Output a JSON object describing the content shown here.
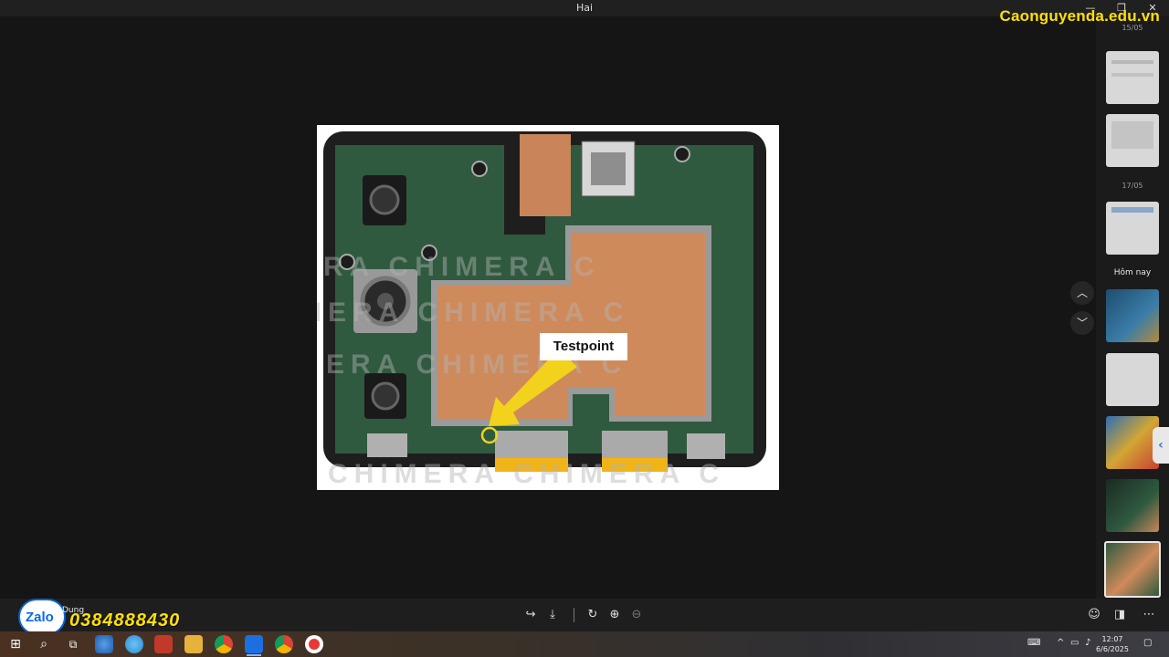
{
  "window": {
    "title": "Hai",
    "minimize_glyph": "—",
    "maximize_glyph": "❐",
    "close_glyph": "✕"
  },
  "overlay": {
    "site_watermark": "Caonguyenda.edu.vn",
    "zalo_label": "Zalo",
    "phone": "0384888430"
  },
  "photo": {
    "callout_label": "Testpoint",
    "watermark_text": "CHIMERA",
    "board_colors": {
      "pcb": "#2f5a3f",
      "copper": "#cf8a5b",
      "arrow": "#f2d21b",
      "frame": "#1e1e1e"
    }
  },
  "side_panel": {
    "date_top": "15/05",
    "date_mid": "17/05",
    "date_today": "Hôm nay",
    "thumbnails": [
      {
        "kind": "document-screenshot"
      },
      {
        "kind": "document-screenshot"
      },
      {
        "kind": "document-screenshot"
      },
      {
        "kind": "board-photo"
      },
      {
        "kind": "document-screenshot"
      },
      {
        "kind": "colorful-board"
      },
      {
        "kind": "board-photo"
      },
      {
        "kind": "board-photo-selected"
      }
    ]
  },
  "nav": {
    "up_icon": "chevron-up-icon",
    "down_icon": "chevron-down-icon"
  },
  "bottom_bar": {
    "sender": "Dung",
    "icons": [
      "share-icon",
      "download-icon",
      "rotate-icon",
      "zoom-in-icon",
      "zoom-out-icon",
      "emoji-icon",
      "panel-icon",
      "more-icon"
    ]
  },
  "taskbar": {
    "time": "12:07",
    "date": "6/6/2025",
    "apps": [
      "start-icon",
      "search-icon",
      "task-view-icon",
      "browser-icon",
      "telegram-icon",
      "app-icon",
      "file-explorer-icon",
      "chrome-icon",
      "zalo-app-icon",
      "chrome-icon-2",
      "record-icon"
    ]
  }
}
